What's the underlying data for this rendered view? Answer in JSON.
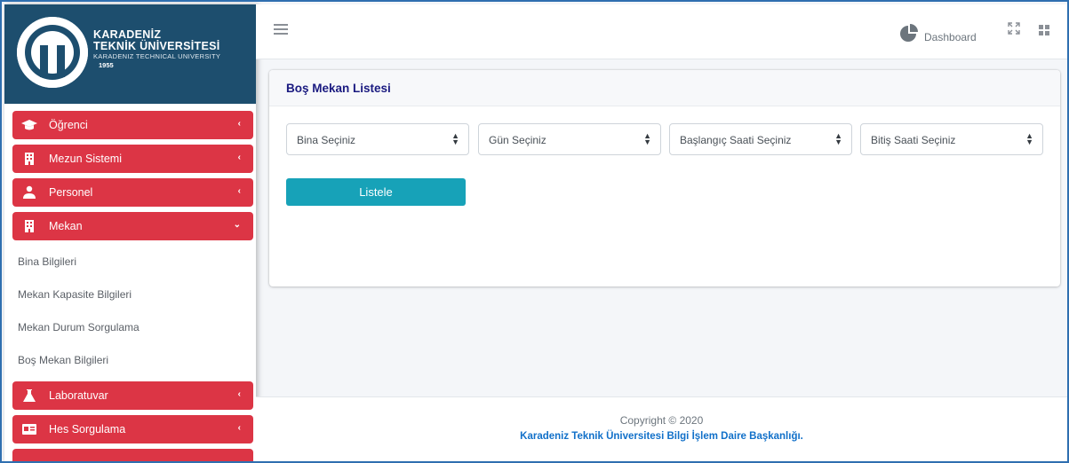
{
  "brand": {
    "line1": "KARADENİZ",
    "line2": "TEKNİK ÜNİVERSİTESİ",
    "line3": "KARADENIZ TECHNICAL UNIVERSITY",
    "year": "1955",
    "colors": {
      "sidebar_header": "#1d4e6e",
      "menu_red": "#dc3545",
      "button_teal": "#17a2b8",
      "link_blue": "#1170c9"
    }
  },
  "sidebar": {
    "items": [
      {
        "label": "Öğrenci",
        "icon": "graduation-cap-icon",
        "arrow": "‹"
      },
      {
        "label": "Mezun Sistemi",
        "icon": "building-icon",
        "arrow": "‹"
      },
      {
        "label": "Personel",
        "icon": "users-icon",
        "arrow": "‹"
      },
      {
        "label": "Mekan",
        "icon": "building-icon",
        "arrow": "⌄"
      },
      {
        "label": "Laboratuvar",
        "icon": "flask-icon",
        "arrow": "‹"
      },
      {
        "label": "Hes Sorgulama",
        "icon": "id-card-icon",
        "arrow": "‹"
      }
    ],
    "mekan_submenu": [
      "Bina Bilgileri",
      "Mekan Kapasite Bilgileri",
      "Mekan Durum Sorgulama",
      "Boş Mekan Bilgileri"
    ]
  },
  "topbar": {
    "dashboard_label": "Dashboard"
  },
  "card": {
    "title": "Boş Mekan Listesi",
    "selects": [
      {
        "value": "Bina Seçiniz"
      },
      {
        "value": "Gün Seçiniz"
      },
      {
        "value": "Başlangıç Saati Seçiniz"
      },
      {
        "value": "Bitiş Saati Seçiniz"
      }
    ],
    "list_button": "Listele"
  },
  "footer": {
    "copyright": "Copyright © 2020",
    "org": "Karadeniz Teknik Üniversitesi Bilgi İşlem Daire Başkanlığı."
  }
}
